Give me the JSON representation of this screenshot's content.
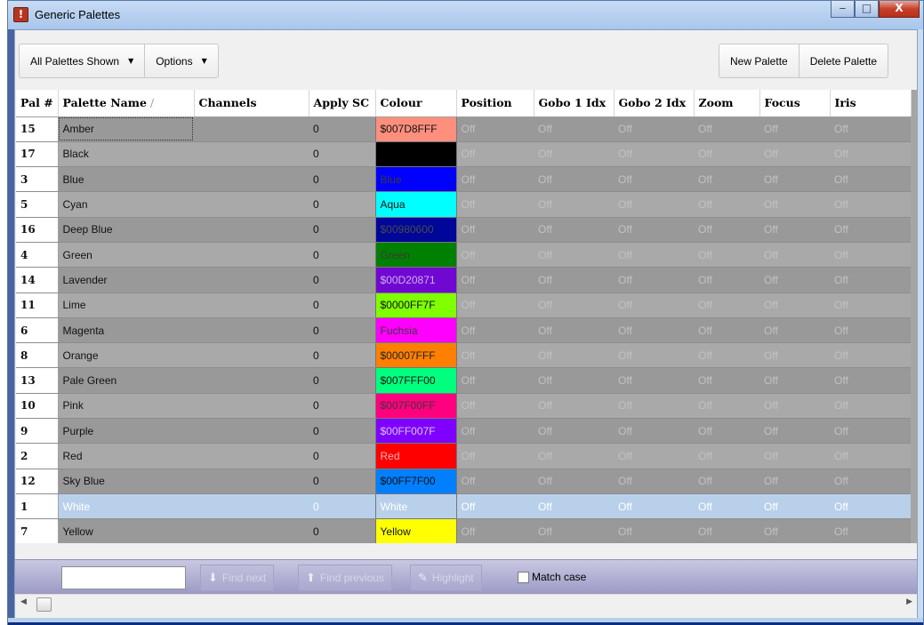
{
  "window": {
    "title": "Generic Palettes",
    "controls": {
      "minimize": "‒",
      "maximize": "□",
      "close": "X"
    }
  },
  "toolbar": {
    "filter_label": "All Palettes Shown",
    "options_label": "Options",
    "new_palette_label": "New Palette",
    "delete_palette_label": "Delete Palette"
  },
  "table": {
    "columns": [
      "Pal #",
      "Palette Name",
      "Channels",
      "Apply SC",
      "Colour",
      "Position",
      "Gobo 1 Idx",
      "Gobo 2 Idx",
      "Zoom",
      "Focus",
      "Iris"
    ],
    "sort_indicator": "/",
    "rows": [
      {
        "num": "15",
        "name": "Amber",
        "channels": "",
        "apply": "0",
        "colour": "$007D8FFF",
        "bg": "#ff8f7d",
        "fg": "#111111",
        "off": "Off"
      },
      {
        "num": "17",
        "name": "Black",
        "channels": "",
        "apply": "0",
        "colour": "",
        "bg": "#000000",
        "fg": "#000000",
        "off": "Off"
      },
      {
        "num": "3",
        "name": "Blue",
        "channels": "",
        "apply": "0",
        "colour": "Blue",
        "bg": "#0000ff",
        "fg": "#3a3a3a",
        "off": "Off"
      },
      {
        "num": "5",
        "name": "Cyan",
        "channels": "",
        "apply": "0",
        "colour": "Aqua",
        "bg": "#00ffff",
        "fg": "#111111",
        "off": "Off"
      },
      {
        "num": "16",
        "name": "Deep Blue",
        "channels": "",
        "apply": "0",
        "colour": "$00980600",
        "bg": "#000698",
        "fg": "#4a4a4a",
        "off": "Off"
      },
      {
        "num": "4",
        "name": "Green",
        "channels": "",
        "apply": "0",
        "colour": "Green",
        "bg": "#008000",
        "fg": "#3a3a3a",
        "off": "Off"
      },
      {
        "num": "14",
        "name": "Lavender",
        "channels": "",
        "apply": "0",
        "colour": "$00D20871",
        "bg": "#7108d2",
        "fg": "#c9b0ee",
        "off": "Off"
      },
      {
        "num": "11",
        "name": "Lime",
        "channels": "",
        "apply": "0",
        "colour": "$0000FF7F",
        "bg": "#7fff00",
        "fg": "#111111",
        "off": "Off"
      },
      {
        "num": "6",
        "name": "Magenta",
        "channels": "",
        "apply": "0",
        "colour": "Fuchsia",
        "bg": "#ff00ff",
        "fg": "#3a3a3a",
        "off": "Off"
      },
      {
        "num": "8",
        "name": "Orange",
        "channels": "",
        "apply": "0",
        "colour": "$00007FFF",
        "bg": "#ff7f00",
        "fg": "#222222",
        "off": "Off"
      },
      {
        "num": "13",
        "name": "Pale Green",
        "channels": "",
        "apply": "0",
        "colour": "$007FFF00",
        "bg": "#00ff7f",
        "fg": "#111111",
        "off": "Off"
      },
      {
        "num": "10",
        "name": "Pink",
        "channels": "",
        "apply": "0",
        "colour": "$007F00FF",
        "bg": "#ff007f",
        "fg": "#3a3a3a",
        "off": "Off"
      },
      {
        "num": "9",
        "name": "Purple",
        "channels": "",
        "apply": "0",
        "colour": "$00FF007F",
        "bg": "#7f00ff",
        "fg": "#d9c6f5",
        "off": "Off"
      },
      {
        "num": "2",
        "name": "Red",
        "channels": "",
        "apply": "0",
        "colour": "Red",
        "bg": "#ff0000",
        "fg": "#f2b3b3",
        "off": "Off"
      },
      {
        "num": "12",
        "name": "Sky Blue",
        "channels": "",
        "apply": "0",
        "colour": "$00FF7F00",
        "bg": "#007fff",
        "fg": "#111111",
        "off": "Off"
      },
      {
        "num": "1",
        "name": "White",
        "channels": "",
        "apply": "0",
        "colour": "White",
        "bg": "#b9d0ea",
        "fg": "#ffffff",
        "off": "Off",
        "selected": true
      },
      {
        "num": "7",
        "name": "Yellow",
        "channels": "",
        "apply": "0",
        "colour": "Yellow",
        "bg": "#ffff00",
        "fg": "#111111",
        "off": "Off"
      }
    ]
  },
  "findbar": {
    "search_value": "",
    "find_next_label": "Find next",
    "find_previous_label": "Find previous",
    "highlight_label": "Highlight",
    "match_case_label": "Match case"
  },
  "scroll": {
    "left_arrow": "◀",
    "right_arrow": "▶"
  }
}
